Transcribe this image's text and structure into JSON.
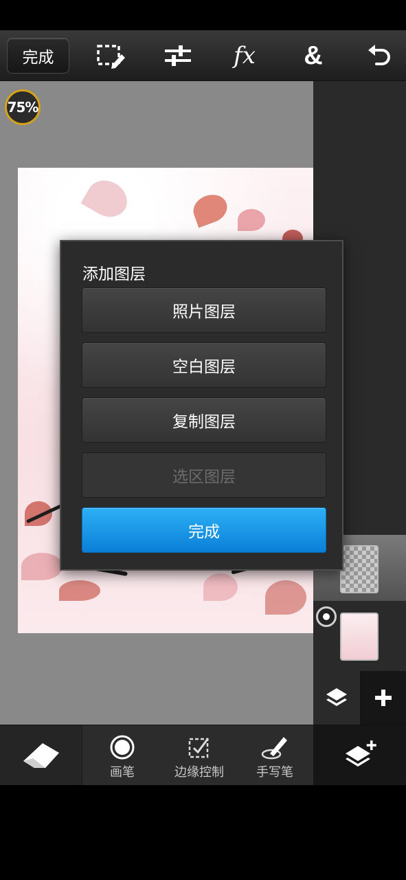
{
  "toolbar": {
    "done_label": "完成",
    "icons": [
      "selection-icon",
      "adjustments-icon",
      "fx-icon",
      "blend-icon",
      "undo-icon"
    ],
    "fx_glyph": "fx",
    "amp_glyph": "&"
  },
  "zoom": {
    "label": "75%",
    "value": 75
  },
  "dialog": {
    "title": "添加图层",
    "options": {
      "photo_layer": "照片图层",
      "blank_layer": "空白图层",
      "duplicate_layer": "复制图层",
      "selection_layer": "选区图层"
    },
    "done_label": "完成"
  },
  "bottom_tools": {
    "brush": "画笔",
    "edge_control": "边缘控制",
    "stylus": "手写笔"
  },
  "colors": {
    "accent_blue": "#1a9ae8",
    "zoom_ring": "#d6a21a",
    "toolbar_bg": "#2a2a2a"
  }
}
